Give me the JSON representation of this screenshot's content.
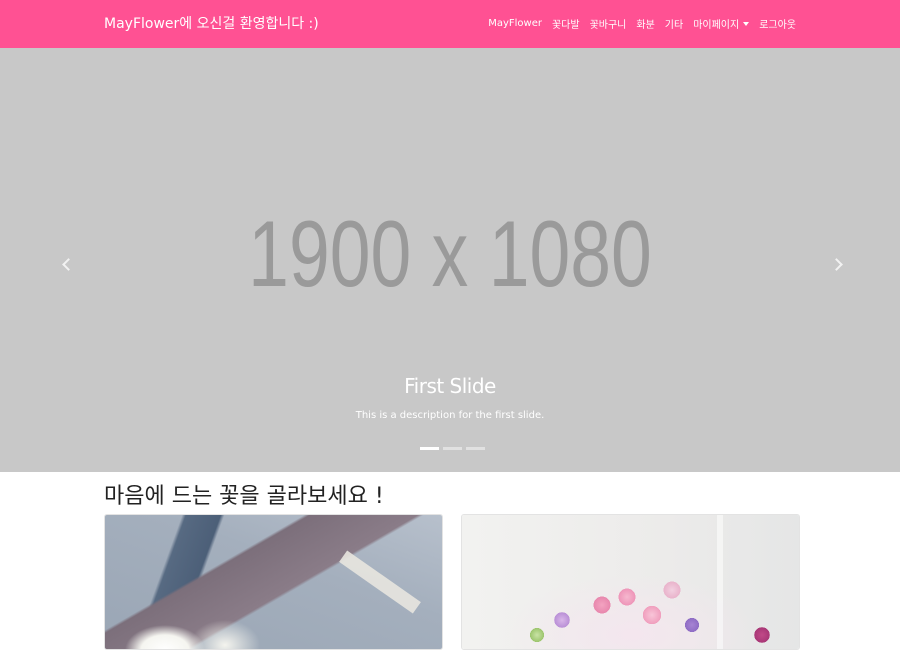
{
  "navbar": {
    "brand": "MayFlower에 오신걸 환영합니다 :)",
    "links": [
      "MayFlower",
      "꽃다발",
      "꽃바구니",
      "화분",
      "기타"
    ],
    "mypage": "마이페이지",
    "logout": "로그아웃",
    "color": "#ff5193"
  },
  "carousel": {
    "placeholder": "1900 x 1080",
    "caption_title": "First Slide",
    "caption_desc": "This is a description for the first slide.",
    "slide_count": 3,
    "active_slide": 1
  },
  "section": {
    "title": "마음에 드는 꽃을 골라보세요 !"
  },
  "products": [
    {
      "image": "bouquet-photo"
    },
    {
      "image": "flower-basket-photo"
    }
  ]
}
